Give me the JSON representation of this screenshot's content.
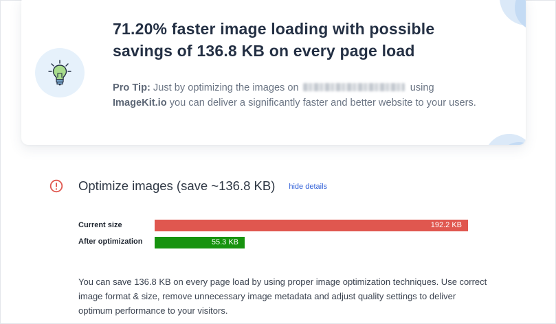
{
  "banner": {
    "headline": "71.20% faster image loading with possible savings of 136.8 KB on every page load",
    "tip_label": "Pro Tip:",
    "tip_text_before": " Just by optimizing the images on ",
    "tip_text_after": " using",
    "tip_brand": "ImageKit.io",
    "tip_text_end": " you can deliver a significantly faster and better website to your users.",
    "icon": "lightbulb-icon"
  },
  "audit": {
    "title": "Optimize images (save ~136.8 KB)",
    "hide_details_label": "hide details",
    "status_icon": "alert-circle-icon",
    "status_color": "#e0574f",
    "current_size_label": "Current size",
    "current_size_value": "192.2 KB",
    "current_size_kb": 192.2,
    "after_label": "After optimization",
    "after_value": "55.3 KB",
    "after_size_kb": 55.3,
    "current_color": "#e0574f",
    "after_color": "#17930f",
    "summary": "You can save 136.8 KB on every page load by using proper image optimization techniques. Use correct image format & size, remove unnecessary image metadata and adjust quality settings to deliver optimum performance to your visitors."
  }
}
